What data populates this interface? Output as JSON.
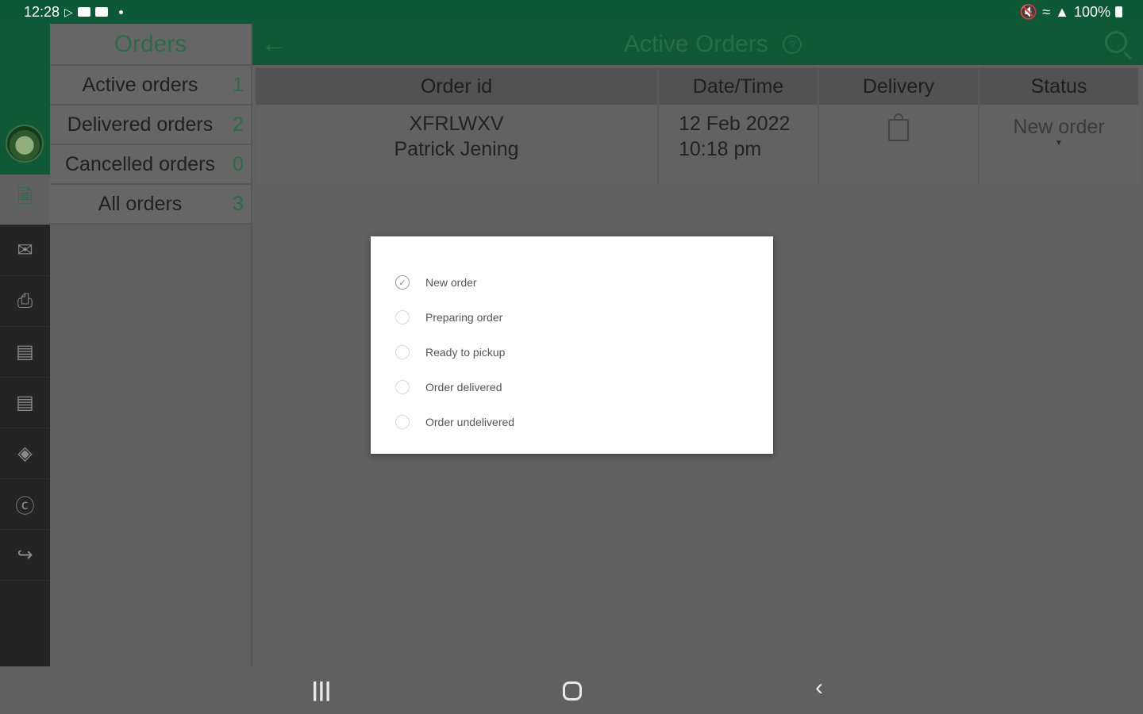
{
  "status_bar": {
    "time": "12:28",
    "battery": "100%"
  },
  "sidebar": {
    "title": "Orders",
    "items": [
      {
        "label": "Active orders",
        "count": "1"
      },
      {
        "label": "Delivered orders",
        "count": "2"
      },
      {
        "label": "Cancelled orders",
        "count": "0"
      },
      {
        "label": "All orders",
        "count": "3"
      }
    ]
  },
  "header": {
    "title": "Active Orders"
  },
  "table": {
    "columns": [
      "Order id",
      "Date/Time",
      "Delivery",
      "Status"
    ],
    "rows": [
      {
        "order_id": "XFRLWXV",
        "customer": "Patrick Jening",
        "date": "12 Feb 2022",
        "time": "10:18 pm",
        "status": "New order"
      }
    ]
  },
  "dialog": {
    "options": [
      "New order",
      "Preparing order",
      "Ready to pickup",
      "Order delivered",
      "Order undelivered"
    ],
    "selected": "New order"
  },
  "icons": {
    "rail": [
      "orders-icon",
      "mail-icon",
      "printer-icon",
      "store-icon",
      "report-icon",
      "chat-icon",
      "help-icon",
      "logout-icon"
    ]
  },
  "colors": {
    "brand_green": "#0f5a34",
    "accent_green": "#2a6c44"
  }
}
